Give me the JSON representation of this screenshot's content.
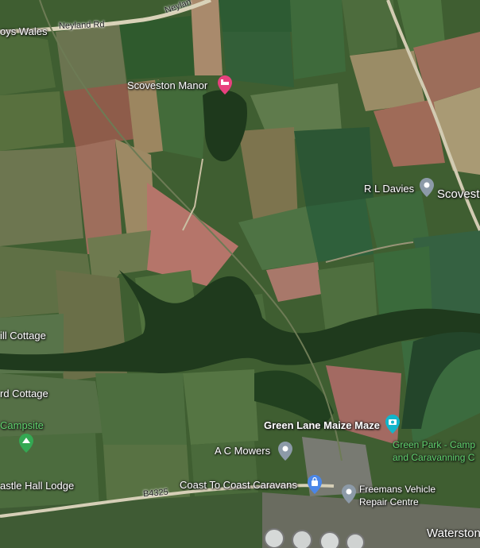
{
  "roads": {
    "neyland_rd": "Neyland Rd",
    "neyland_partial": "Neylan",
    "b4325": "B4325"
  },
  "places": {
    "boys_wales": "oys Wales",
    "scoveston_manor": "Scoveston Manor",
    "rl_davies": "R L Davies",
    "scoveston": "Scovest",
    "hill_cottage": "ill Cottage",
    "rd_cottage": "rd Cottage",
    "campsite": "Campsite",
    "green_lane_maize_maze": "Green Lane Maize Maze",
    "green_park_line1": "Green Park - Camp",
    "green_park_line2": "and Caravanning C",
    "ac_mowers": "A C Mowers",
    "coast_to_coast": "Coast To Coast Caravans",
    "freemans_line1": "Freemans Vehicle",
    "freemans_line2": "Repair Centre",
    "castle_hall_lodge": "astle Hall Lodge",
    "waterston": "Waterston"
  },
  "colors": {
    "hotel_pin": "#e8417e",
    "attraction_pin": "#12b5cb",
    "shop_pin": "#4a86e8",
    "place_pin": "#8c9aa8",
    "campsite_pin": "#34a853",
    "label_green": "#5fd36b"
  },
  "icons": {
    "hotel": "bed-icon",
    "attraction": "camera-icon",
    "shop": "shopping-bag-icon",
    "place": "location-pin-icon",
    "campsite": "tent-icon"
  }
}
